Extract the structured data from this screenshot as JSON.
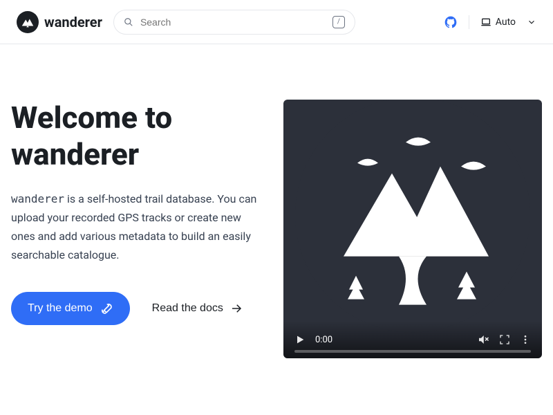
{
  "brand": {
    "name": "wanderer"
  },
  "search": {
    "placeholder": "Search",
    "shortcut": "/"
  },
  "theme": {
    "label": "Auto"
  },
  "hero": {
    "title": "Welcome to wanderer",
    "app_name": "wanderer",
    "description_rest": " is a self-hosted trail database. You can upload your recorded GPS tracks or create new ones and add various metadata to build an easily searchable catalogue.",
    "demo_label": "Try the demo",
    "docs_label": "Read the docs"
  },
  "video": {
    "time": "0:00"
  }
}
